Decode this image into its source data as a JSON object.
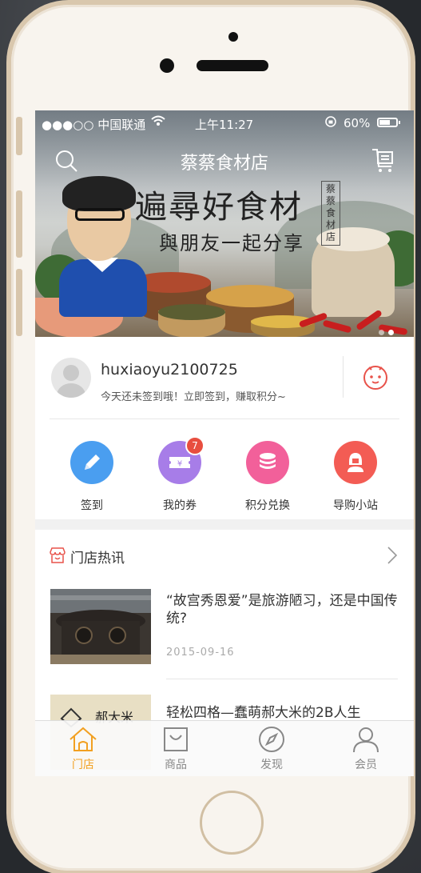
{
  "status_bar": {
    "carrier": "●●●○○ 中国联通",
    "time": "上午11:27",
    "battery": "60%"
  },
  "header": {
    "title": "蔡蔡食材店",
    "search_icon": "search-icon",
    "cart_icon": "cart-icon"
  },
  "banner": {
    "slogan_main": "遍尋好食材",
    "slogan_sub": "與朋友一起分享",
    "seal_text": "蔡蔡食材店",
    "active_slide": 2,
    "slide_count": 2
  },
  "user": {
    "username": "huxiaoyu2100725",
    "signin_hint": "今天还未签到哦！立即签到，赚取积分~"
  },
  "actions": [
    {
      "label": "签到",
      "icon": "pencil-icon",
      "color": "#4a9ef0"
    },
    {
      "label": "我的券",
      "icon": "ticket-icon",
      "color": "#a77de8",
      "badge": "7"
    },
    {
      "label": "积分兑换",
      "icon": "coins-icon",
      "color": "#f2609a"
    },
    {
      "label": "导购小站",
      "icon": "guide-icon",
      "color": "#f35c54"
    }
  ],
  "news": {
    "section_title": "门店热讯",
    "items": [
      {
        "title": "“故宫秀恩爱”是旅游陋习，还是中国传统?",
        "date": "2015-09-16"
      },
      {
        "title": "轻松四格—蠢萌郝大米的2B人生"
      }
    ]
  },
  "tabbar": {
    "items": [
      {
        "label": "门店",
        "icon": "store-icon",
        "active": true
      },
      {
        "label": "商品",
        "icon": "bag-icon",
        "active": false
      },
      {
        "label": "发现",
        "icon": "compass-icon",
        "active": false
      },
      {
        "label": "会员",
        "icon": "member-icon",
        "active": false
      }
    ],
    "active_color": "#f2a021"
  }
}
